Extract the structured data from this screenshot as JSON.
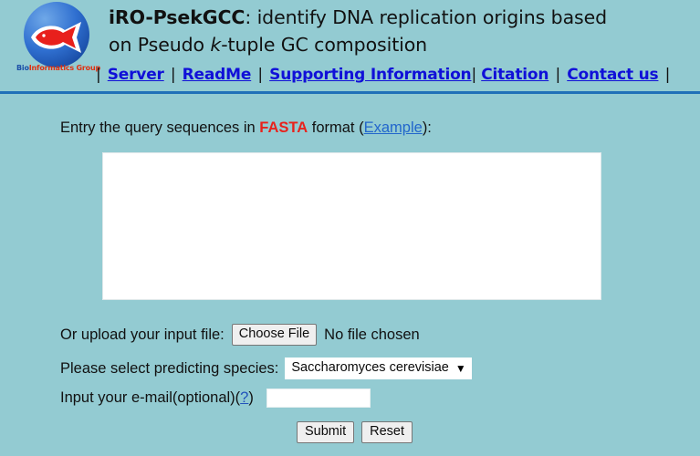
{
  "header": {
    "logo": {
      "alt": "BioInformatics Group fish logo",
      "caption_part1": "Bio",
      "caption_part2": "Informatics",
      "caption_part3": " Group"
    },
    "title": {
      "app_name": "iRO-PsekGCC",
      "rest_line1": ": identify DNA replication origins based",
      "line2_pre": "on  Pseudo ",
      "line2_italic": "k",
      "line2_post": "-tuple GC composition"
    },
    "nav": {
      "lead_pipe": "|",
      "items": [
        {
          "label": "Server"
        },
        {
          "label": "ReadMe"
        },
        {
          "label": "Supporting Information"
        },
        {
          "label": "Citation"
        },
        {
          "label": "Contact us"
        }
      ],
      "separator": "|",
      "trailing_pipe": "|"
    }
  },
  "main": {
    "prompt": {
      "pre": "Entry the query sequences in ",
      "format": "FASTA",
      "mid": " format (",
      "example_link": "Example",
      "post": "):"
    },
    "sequence_textarea": {
      "value": "",
      "placeholder": ""
    },
    "upload": {
      "label": "Or upload your input file:",
      "button_label": "Choose File",
      "status": "No file chosen"
    },
    "species": {
      "label": "Please select predicting species:",
      "selected": "Saccharomyces cerevisiae",
      "caret": "▼"
    },
    "email": {
      "label_pre": "Input your e-mail(optional)(",
      "help_link": "?",
      "label_post": ")",
      "value": "",
      "placeholder": ""
    },
    "actions": {
      "submit_label": "Submit",
      "reset_label": "Reset"
    }
  },
  "colors": {
    "page_background": "#93cbd2",
    "divider": "#1f70b8",
    "link": "#1010d8",
    "fasta_red": "#e8221c",
    "logo_red": "#e03010",
    "logo_blue": "#1b4fa8"
  }
}
